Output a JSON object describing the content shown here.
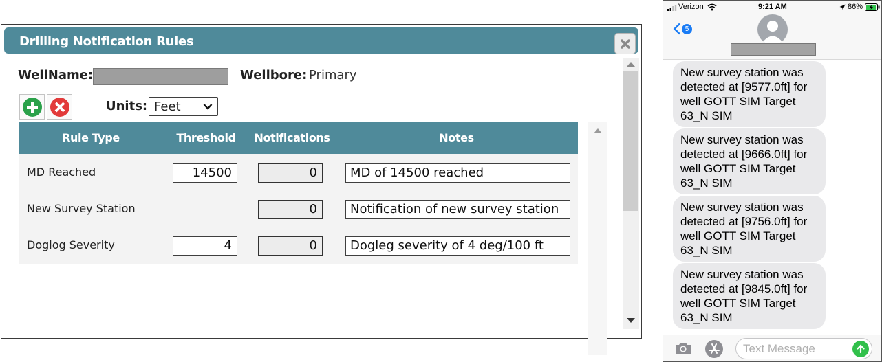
{
  "dialog": {
    "title": "Drilling Notification Rules",
    "wellname_label": "WellName:",
    "wellbore_label": "Wellbore:",
    "wellbore_value": "Primary",
    "units_label": "Units:",
    "units_value": "Feet",
    "columns": [
      "Rule Type",
      "Threshold",
      "Notifications",
      "Notes"
    ],
    "rows": [
      {
        "rule_type": "MD Reached",
        "threshold": "14500",
        "notifications": "0",
        "notes": "MD of 14500 reached"
      },
      {
        "rule_type": "New Survey Station",
        "threshold": "",
        "notifications": "0",
        "notes": "Notification of new survey station"
      },
      {
        "rule_type": "Doglog Severity",
        "threshold": "4",
        "notifications": "0",
        "notes": "Dogleg severity of 4 deg/100 ft"
      }
    ],
    "colors": {
      "header": "#4f8a9a",
      "add": "#2aa14a",
      "delete": "#e23a3a"
    },
    "icons": [
      "close-icon",
      "add-icon",
      "delete-icon",
      "chevron-down-icon",
      "scroll-up-icon",
      "scroll-down-icon"
    ]
  },
  "phone": {
    "carrier": "Verizon",
    "time": "9:21 AM",
    "battery": "86%",
    "back_badge": "5",
    "messages": [
      "New survey station was detected at [9577.0ft] for well GOTT SIM Target 63_N SIM",
      "New survey station was detected at [9666.0ft] for well GOTT SIM Target 63_N SIM",
      "New survey station was detected at [9756.0ft] for well GOTT SIM Target 63_N SIM",
      "New survey station was detected at [9845.0ft] for well GOTT SIM Target 63_N SIM"
    ],
    "input_placeholder": "Text Message",
    "colors": {
      "accent": "#1a7cf5",
      "send": "#31c04b",
      "bubble": "#e9e9eb"
    },
    "icons": [
      "signal-icon",
      "wifi-icon",
      "location-icon",
      "battery-icon",
      "back-chevron-icon",
      "avatar-icon",
      "camera-icon",
      "app-store-icon",
      "send-arrow-icon"
    ]
  }
}
